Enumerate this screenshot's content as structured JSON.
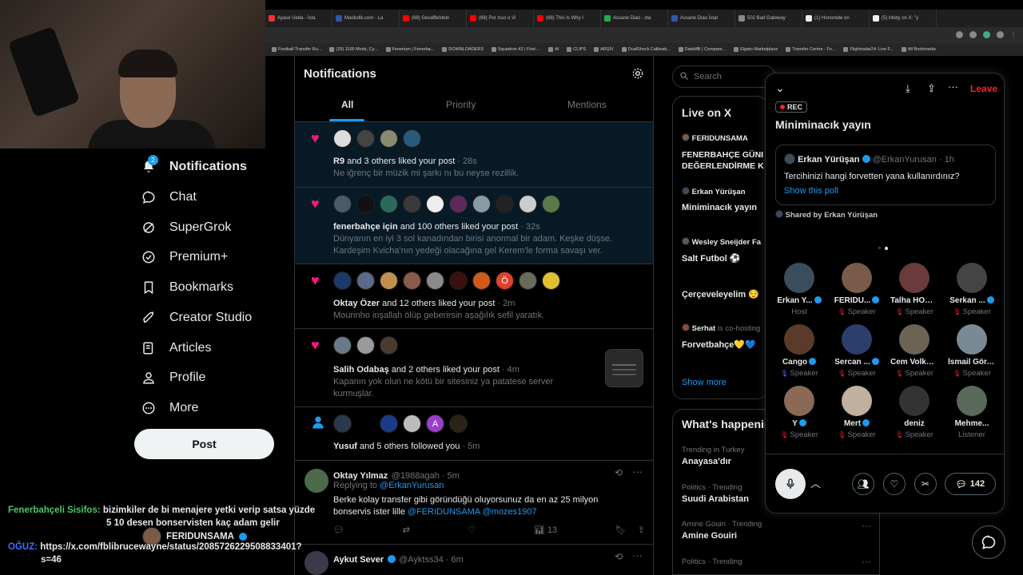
{
  "browser": {
    "tabs": [
      {
        "label": "Ayase Ueda - İsta",
        "color": "#e33"
      },
      {
        "label": "Mackolik.com - La",
        "color": "#35a"
      },
      {
        "label": "(68) Gesaffelstein",
        "color": "#f00"
      },
      {
        "label": "(68) Por Isso o Vi",
        "color": "#f00"
      },
      {
        "label": "(68) This Is Why I",
        "color": "#f00"
      },
      {
        "label": "Assane Diao - sta",
        "color": "#2a5"
      },
      {
        "label": "Assane Diao İstat",
        "color": "#35a"
      },
      {
        "label": "502 Bad Gateway",
        "color": "#888"
      },
      {
        "label": "(1) Honorede on",
        "color": "#eee"
      },
      {
        "label": "(5) Moby on X: \"y",
        "color": "#eee"
      }
    ],
    "bookmarks": [
      "Football Transfer Ru...",
      "(29) 1100 Mods, Cy...",
      "Fenerium | Fenerba...",
      "DOWNLOADERS",
      "Squadron 42 | First-...",
      "AI",
      "CLIPS",
      "ARŞİV",
      "DualShock Calibrati...",
      "DataMB | Compare...",
      "Elgato Marketplace",
      "Transfer Centre - Fo...",
      "Flightradar24: Live F...",
      "All Bookmarks"
    ]
  },
  "nav": {
    "notif_badge": "2",
    "items": [
      {
        "label": "Notifications"
      },
      {
        "label": "Chat"
      },
      {
        "label": "SuperGrok"
      },
      {
        "label": "Premium+"
      },
      {
        "label": "Bookmarks"
      },
      {
        "label": "Creator Studio"
      },
      {
        "label": "Articles"
      },
      {
        "label": "Profile"
      },
      {
        "label": "More"
      }
    ],
    "post_label": "Post"
  },
  "main": {
    "title": "Notifications",
    "tabs": [
      "All",
      "Priority",
      "Mentions"
    ],
    "notifications": [
      {
        "actor": "R9",
        "rest": " and 3 others liked your post",
        "time": " · 28s",
        "body": "Ne iğrenç bir müzik mi şarkı nı bu neyse rezillik."
      },
      {
        "actor": "fenerbahçe için",
        "rest": " and 100 others liked your post",
        "time": " · 32s",
        "body": "Dünyanın en iyi 3 sol kanadından birisi anormal bir adam. Keşke düşse. Kardeşim Kvicha'nın yedeği olacağına gel Kerem'le forma savaşı ver."
      },
      {
        "actor": "Oktay Özer",
        "rest": " and 12 others liked your post",
        "time": " · 2m",
        "body": "Mourinho inşallah ölüp geberirsin aşağılık sefil yaratık."
      },
      {
        "actor": "Salih Odabaş",
        "rest": " and 2 others liked your post",
        "time": " · 4m",
        "body": "Kapanın yok olun ne kötü bir sitesiniz ya patatese server kurmuşlar."
      },
      {
        "actor": "Yusuf",
        "rest": " and 5 others followed you",
        "time": " · 5m",
        "body": ""
      }
    ],
    "tweet1": {
      "name": "Oktay Yılmaz",
      "handle": "@1988agah · 5m",
      "replying_prefix": "Replying to ",
      "replying_to": "@ErkanYurusan",
      "text_start": "Berke kolay transfer gibi göründüğü oluyorsunuz da en az 25 milyon bonservis ister lille ",
      "mention1": "@FERIDUNSAMA",
      "mention2": "@mozes1907",
      "views": "13"
    },
    "tweet2": {
      "name": "Aykut Sever",
      "handle": "@Ayktss34 · 6m"
    }
  },
  "right": {
    "search_placeholder": "Search",
    "live_title": "Live on X",
    "live_items": [
      {
        "host": "FERIDUNSAMA",
        "title": "FENERBAHÇE GÜNI DEĞERLENDİRME K"
      },
      {
        "host": "Erkan Yürüşan",
        "title": "Miniminacık yayın"
      },
      {
        "host": "Wesley Sneijder Fa",
        "title": "Salt Futbol ⚽"
      },
      {
        "host": "",
        "title": "Çerçeveleyelim 😌"
      },
      {
        "host": "Serhat",
        "host_suffix": " is co-hosting",
        "title": "Forvetbahçe💛💙"
      }
    ],
    "show_more": "Show more",
    "whats_title": "What's happening",
    "trends": [
      {
        "meta": "Trending in Turkey",
        "name": "Anayasa'dır"
      },
      {
        "meta": "Politics · Trending",
        "name": "Suudi Arabistan"
      },
      {
        "meta": "Amine Gouiri · Trending",
        "name": "Amine Gouiri"
      },
      {
        "meta": "Politics · Trending",
        "name": ""
      }
    ]
  },
  "space": {
    "leave": "Leave",
    "rec": "REC",
    "title": "Miniminacık yayın",
    "pinned": {
      "name": "Erkan Yürüşan",
      "handle": "@ErkanYurusan · 1h",
      "text": "Tercihinizi hangi forvetten yana kullanırdınız?",
      "poll_link": "Show this poll"
    },
    "shared_by": "Shared by Erkan Yürüşan",
    "participants": [
      {
        "name": "Erkan Y...",
        "role": "Host",
        "color": "#3b4d5c"
      },
      {
        "name": "FERIDU...",
        "role": "Speaker",
        "color": "#7a5a48"
      },
      {
        "name": "Talha HOCA",
        "role": "Speaker",
        "color": "#6b3a3a"
      },
      {
        "name": "Serkan ...",
        "role": "Speaker",
        "color": "#444"
      },
      {
        "name": "Cango",
        "role": "Speaker",
        "color": "#5a3b2a"
      },
      {
        "name": "Sercan ...",
        "role": "Speaker",
        "color": "#2c3e6b"
      },
      {
        "name": "Cem Volkan",
        "role": "Speaker",
        "color": "#6b6455"
      },
      {
        "name": "İsmail Gör...",
        "role": "Speaker",
        "color": "#7a8a95"
      },
      {
        "name": "Y",
        "role": "Speaker",
        "color": "#8a6a55"
      },
      {
        "name": "Mert",
        "role": "Speaker",
        "color": "#c0b0a0"
      },
      {
        "name": "deniz",
        "role": "Speaker",
        "color": "#333"
      },
      {
        "name": "Mehme...",
        "role": "Listener",
        "color": "#5a6a5a"
      }
    ],
    "comment_count": "142"
  },
  "chat": {
    "line1_user": "Fenerbahçeli Sisifos:",
    "line1_msg": "bizimkiler de bi menajere yetki verip satsa yüzde",
    "line1_msg2": "5 10 desen bonservisten kaç adam gelir",
    "overlay_name": "FERIDUNSAMA",
    "line2_user": "OĞUZ:",
    "line2_msg": "https://x.com/fblibrucewayne/status/2085726229508833401?",
    "line2_msg2": "s=46"
  },
  "colors": {
    "accent": "#1d9bf0",
    "like": "#f91880",
    "leave": "#f4212e"
  }
}
